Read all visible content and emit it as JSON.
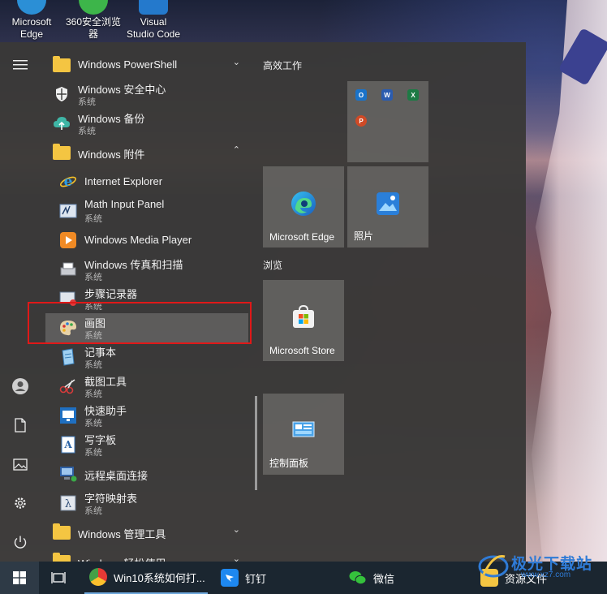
{
  "desktop": {
    "icons": [
      {
        "label": "Microsoft\nEdge",
        "color": "#2b8fd6"
      },
      {
        "label": "360安全浏览\n器",
        "color": "#3db54a"
      },
      {
        "label": "Visual\nStudio Code",
        "color": "#2479cc"
      }
    ]
  },
  "rail": {
    "menu_icon": "hamburger-icon",
    "user_icon": "user-icon",
    "documents_icon": "document-icon",
    "pictures_icon": "picture-icon",
    "settings_icon": "gear-icon",
    "power_icon": "power-icon"
  },
  "apps": [
    {
      "name": "Windows PowerShell",
      "type": "folder",
      "expand": "⌄"
    },
    {
      "name": "Windows 安全中心",
      "cat": "系统"
    },
    {
      "name": "Windows 备份",
      "cat": "系统"
    },
    {
      "name": "Windows 附件",
      "type": "folder",
      "expand": "⌃"
    },
    {
      "name": "Internet Explorer"
    },
    {
      "name": "Math Input Panel",
      "cat": "系统"
    },
    {
      "name": "Windows Media Player"
    },
    {
      "name": "Windows 传真和扫描",
      "cat": "系统"
    },
    {
      "name": "步骤记录器",
      "cat": "系统"
    },
    {
      "name": "画图",
      "cat": "系统"
    },
    {
      "name": "记事本",
      "cat": "系统"
    },
    {
      "name": "截图工具",
      "cat": "系统"
    },
    {
      "name": "快速助手",
      "cat": "系统"
    },
    {
      "name": "写字板",
      "cat": "系统"
    },
    {
      "name": "远程桌面连接"
    },
    {
      "name": "字符映射表",
      "cat": "系统"
    },
    {
      "name": "Windows 管理工具",
      "type": "folder",
      "expand": "⌄"
    },
    {
      "name": "Windows 轻松使用",
      "type": "folder",
      "expand": "⌄"
    }
  ],
  "tiles": {
    "group1_label": "高效工作",
    "group2_label": "浏览",
    "office_minis": [
      "O",
      "W",
      "X",
      "P"
    ],
    "edge_label": "Microsoft Edge",
    "photos_label": "照片",
    "store_label": "Microsoft Store",
    "control_label": "控制面板"
  },
  "taskbar": {
    "chrome_label": "Win10系统如何打...",
    "dingtalk_label": "钉钉",
    "wechat_label": "微信",
    "explorer_label": "资源文件"
  },
  "watermark": {
    "text": "极光下载站",
    "url": "www.xz7.com"
  }
}
